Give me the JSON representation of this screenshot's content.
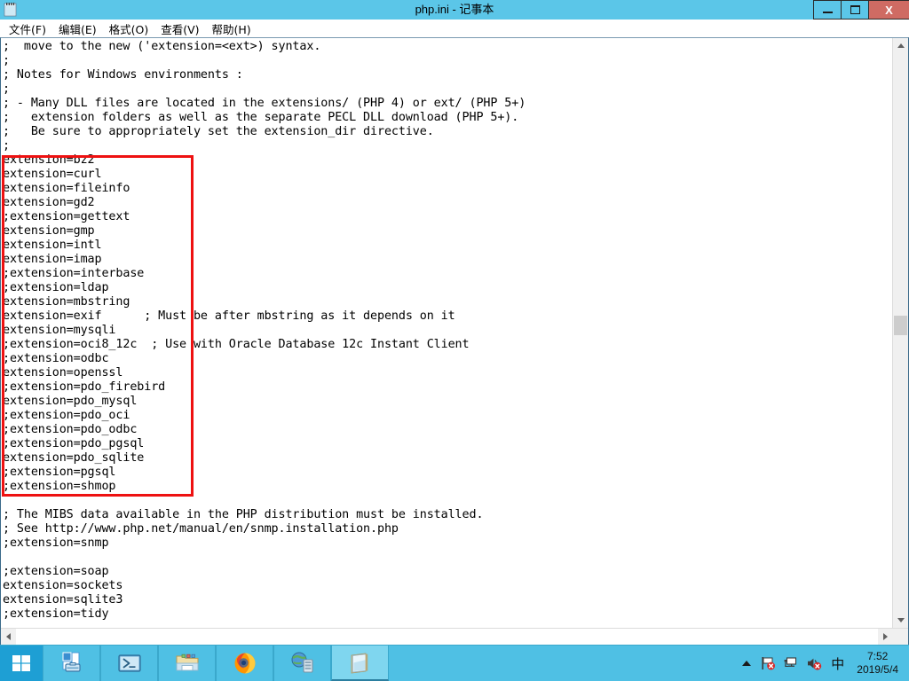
{
  "window": {
    "title": "php.ini - 记事本",
    "icon": "notepad-icon",
    "titlebar_color": "#5bc6e8",
    "close_color": "#cf6b63",
    "buttons": {
      "minimize_label": "",
      "restore_label": "",
      "close_label": "X"
    }
  },
  "menu": {
    "items": [
      {
        "label": "文件(F)"
      },
      {
        "label": "编辑(E)"
      },
      {
        "label": "格式(O)"
      },
      {
        "label": "查看(V)"
      },
      {
        "label": "帮助(H)"
      }
    ]
  },
  "editor": {
    "content": ";  move to the new ('extension=<ext>) syntax.\n;\n; Notes for Windows environments :\n;\n; - Many DLL files are located in the extensions/ (PHP 4) or ext/ (PHP 5+)\n;   extension folders as well as the separate PECL DLL download (PHP 5+).\n;   Be sure to appropriately set the extension_dir directive.\n;\nextension=bz2\nextension=curl\nextension=fileinfo\nextension=gd2\n;extension=gettext\nextension=gmp\nextension=intl\nextension=imap\n;extension=interbase\n;extension=ldap\nextension=mbstring\nextension=exif      ; Must be after mbstring as it depends on it\nextension=mysqli\n;extension=oci8_12c  ; Use with Oracle Database 12c Instant Client\n;extension=odbc\nextension=openssl\n;extension=pdo_firebird\nextension=pdo_mysql\n;extension=pdo_oci\n;extension=pdo_odbc\n;extension=pdo_pgsql\nextension=pdo_sqlite\n;extension=pgsql\n;extension=shmop\n\n; The MIBS data available in the PHP distribution must be installed.\n; See http://www.php.net/manual/en/snmp.installation.php\n;extension=snmp\n\n;extension=soap\nextension=sockets\nextension=sqlite3\n;extension=tidy"
  },
  "annotation": {
    "name": "red-highlight-rectangle",
    "color": "#ee1111",
    "enclosed_lines": [
      "extension=bz2",
      "extension=curl",
      "extension=fileinfo",
      "extension=gd2",
      ";extension=gettext",
      "extension=gmp",
      "extension=intl",
      "extension=imap",
      ";extension=interbase",
      ";extension=ldap",
      "extension=mbstring",
      "extension=exif",
      "extension=mysqli",
      ";extension=oci8_12c",
      ";extension=odbc",
      "extension=openssl",
      ";extension=pdo_firebird",
      "extension=pdo_mysql",
      ";extension=pdo_oci",
      ";extension=pdo_odbc",
      ";extension=pdo_pgsql",
      "extension=pdo_sqlite",
      ";extension=pgsql",
      ";extension=shmop"
    ]
  },
  "taskbar": {
    "start": {
      "name": "start-button",
      "label": ""
    },
    "items": [
      {
        "name": "server-manager",
        "icon": "server-manager-icon",
        "active": false
      },
      {
        "name": "powershell",
        "icon": "powershell-icon",
        "active": false
      },
      {
        "name": "file-explorer",
        "icon": "file-explorer-icon",
        "active": false
      },
      {
        "name": "firefox",
        "icon": "firefox-icon",
        "active": false
      },
      {
        "name": "iis-manager",
        "icon": "iis-manager-icon",
        "active": false
      },
      {
        "name": "notepad",
        "icon": "notepad-icon",
        "active": true
      }
    ],
    "tray": {
      "chevron": "show-hidden-icons",
      "flag": "action-center-flag-icon",
      "network": "network-icon",
      "volume": "volume-muted-icon",
      "ime": "中",
      "time": "7:52",
      "date": "2019/5/4"
    }
  }
}
